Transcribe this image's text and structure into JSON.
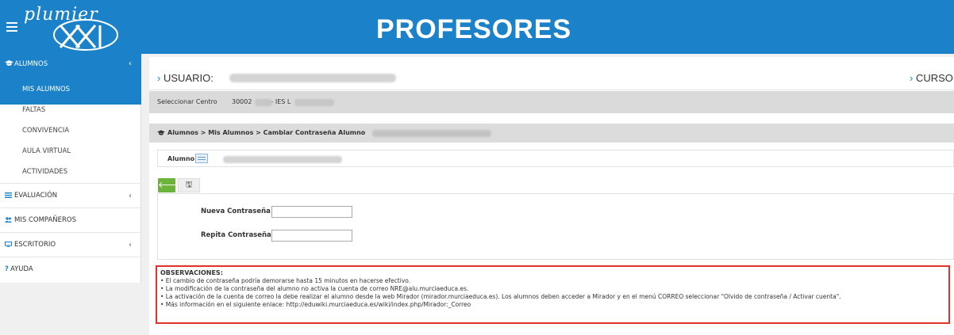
{
  "header": {
    "logo_text": "plumier",
    "logo_mark": "XXI",
    "title": "PROFESORES"
  },
  "sidebar": {
    "alumnos": {
      "label": "ALUMNOS",
      "icon": "graduation-cap-icon"
    },
    "sub_items": [
      "MIS ALUMNOS",
      "FALTAS",
      "CONVIVENCIA",
      "AULA VIRTUAL",
      "ACTIVIDADES"
    ],
    "sections": [
      {
        "label": "EVALUACIÓN",
        "icon": "list-icon",
        "has_chevron": true
      },
      {
        "label": "MIS COMPAÑEROS",
        "icon": "users-icon",
        "has_chevron": false
      },
      {
        "label": "ESCRITORIO",
        "icon": "monitor-icon",
        "has_chevron": true
      },
      {
        "label": "AYUDA",
        "icon": "question-icon",
        "has_chevron": false
      }
    ],
    "chevron": "‹"
  },
  "main": {
    "usuario_label": "USUARIO:",
    "curso_label": "CURSO",
    "gt": "›",
    "center": {
      "label": "Seleccionar Centro",
      "code": "30002",
      "name": "- IES L"
    },
    "breadcrumb": "Alumnos > Mis Alumnos > Cambiar Contraseña Alumno",
    "alumno_label": "Alumno:",
    "toolbar": {
      "back": "🡐",
      "save": "🖫"
    },
    "form": {
      "new_password_label": "Nueva Contraseña",
      "repeat_password_label": "Repita Contraseña",
      "new_password_value": "",
      "repeat_password_value": ""
    },
    "observaciones": {
      "title": "OBSERVACIONES:",
      "lines": [
        "• El cambio de contraseña podría demorarse hasta 15 minutos en hacerse efectivo.",
        "• La modificación de la contraseña del alumno no activa la cuenta de correo NRE@alu.murciaeduca.es.",
        "• La activación de la cuenta de correo la debe realizar el alumno desde la web Mirador (mirador.murciaeduca.es). Los alumnos deben acceder a Mirador y en el menú CORREO seleccionar \"Olvido de contraseña / Activar cuenta\".",
        "• Más información en el siguiente enlace: http://eduwiki.murciaeduca.es/wiki/index.php/Mirador:_Correo"
      ]
    }
  },
  "colors": {
    "primary": "#1b82c9",
    "green": "#6bb33a",
    "alert_border": "#e0342a"
  }
}
